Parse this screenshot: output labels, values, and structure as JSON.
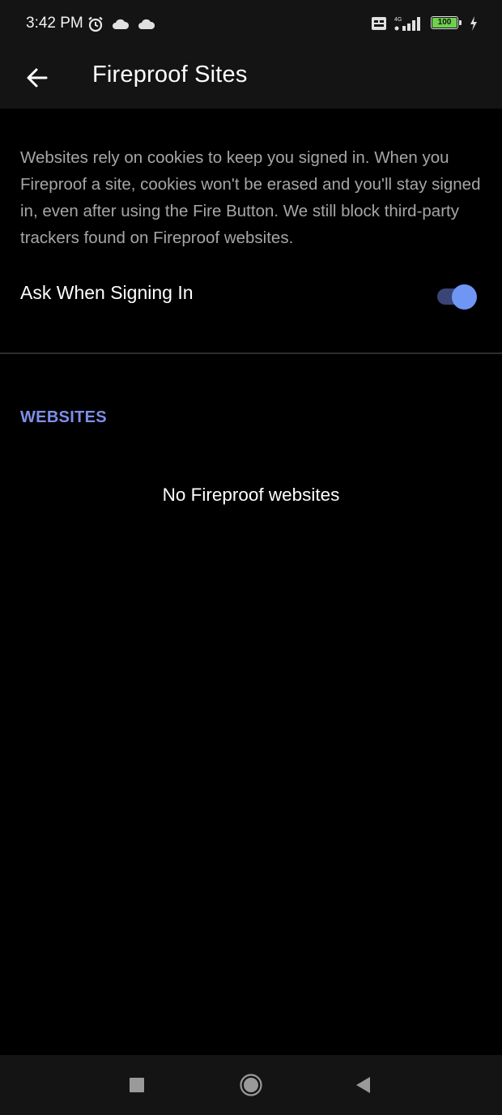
{
  "status_bar": {
    "time": "3:42 PM",
    "battery": "100"
  },
  "header": {
    "title": "Fireproof Sites"
  },
  "content": {
    "description": "Websites rely on cookies to keep you signed in. When you Fireproof a site, cookies won't be erased and you'll stay signed in, even after using the Fire Button. We still block third-party trackers found on Fireproof websites.",
    "ask_when_signing_in": {
      "label": "Ask When Signing In",
      "enabled": true
    },
    "websites_section": {
      "header": "WEBSITES",
      "empty_message": "No Fireproof websites"
    }
  },
  "colors": {
    "accent": "#7096f5",
    "section_header": "#7f8ee8",
    "background": "#000000",
    "bar_background": "#141414"
  },
  "icons": {
    "back": "arrow-left-icon",
    "recents": "square-icon",
    "home": "circle-icon",
    "navigate_back": "triangle-back-icon"
  }
}
